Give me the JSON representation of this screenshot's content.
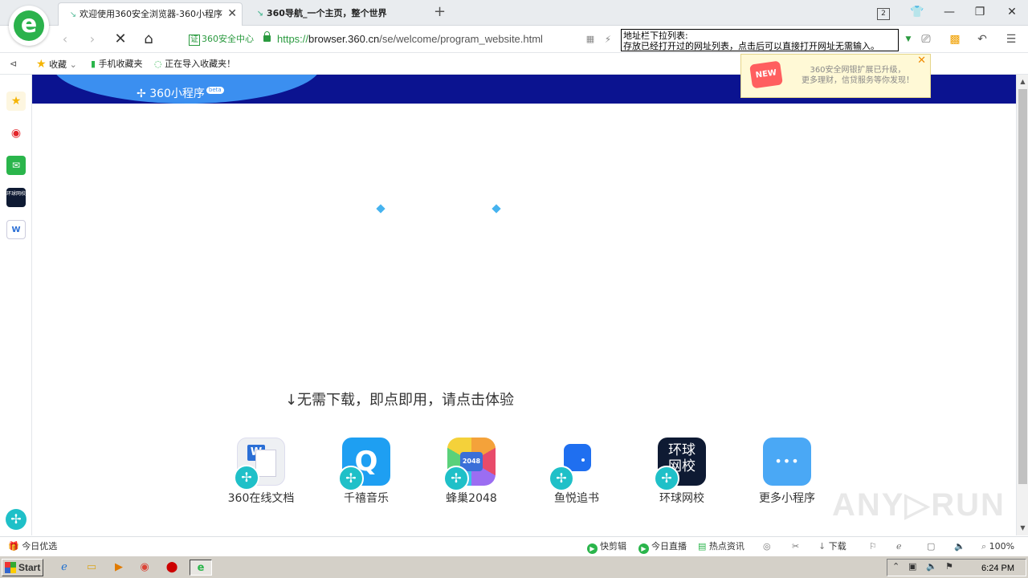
{
  "tabs": [
    {
      "label": "欢迎使用360安全浏览器-360小程序",
      "active": true
    },
    {
      "label": "360导航_一个主页，整个世界",
      "active": false
    }
  ],
  "window_controls": {
    "count_badge": "2"
  },
  "address_bar": {
    "cert_badge": "证",
    "cert_label": "360安全中心",
    "url_scheme": "https://",
    "url_host": "browser.360.cn",
    "url_path": "/se/welcome/program_website.html"
  },
  "tooltip": {
    "line1": "地址栏下拉列表:",
    "line2": "存放已经打开过的网址列表，点击后可以直接打开网址无需输入。"
  },
  "bookmarks": {
    "favorites": "收藏",
    "mobile": "手机收藏夹",
    "importing": "正在导入收藏夹！"
  },
  "notification": {
    "badge": "NEW",
    "line1": "360安全网银扩展已升级，",
    "line2": "更多理财，信贷服务等你发现！"
  },
  "sidebar": {
    "word_icon": "W",
    "news_icon": "环球网校"
  },
  "page": {
    "brand": "360小程序",
    "beta": "beta",
    "tagline": "无需下载，即点即用，请点击体验",
    "apps": [
      {
        "label": "360在线文档",
        "icon": "W",
        "color": "#eef0f3"
      },
      {
        "label": "千禧音乐",
        "icon": "Q",
        "color": "#1e9ff2"
      },
      {
        "label": "蜂巢2048",
        "icon": "2048",
        "color": "#f4a23a"
      },
      {
        "label": "鱼悦追书",
        "icon": "▪",
        "color": "#ffffff"
      },
      {
        "label": "环球网校",
        "icon": "环球网校",
        "color": "#0e1a33"
      },
      {
        "label": "更多小程序",
        "icon": "•••",
        "color": "#4aa8f5"
      }
    ]
  },
  "statusbar": {
    "left": "今日优选",
    "items": [
      "快剪辑",
      "今日直播",
      "热点资讯",
      "下载"
    ],
    "zoom": "100%"
  },
  "taskbar": {
    "start": "Start",
    "clock": "6:24 PM"
  },
  "watermark": "ANY▷RUN"
}
